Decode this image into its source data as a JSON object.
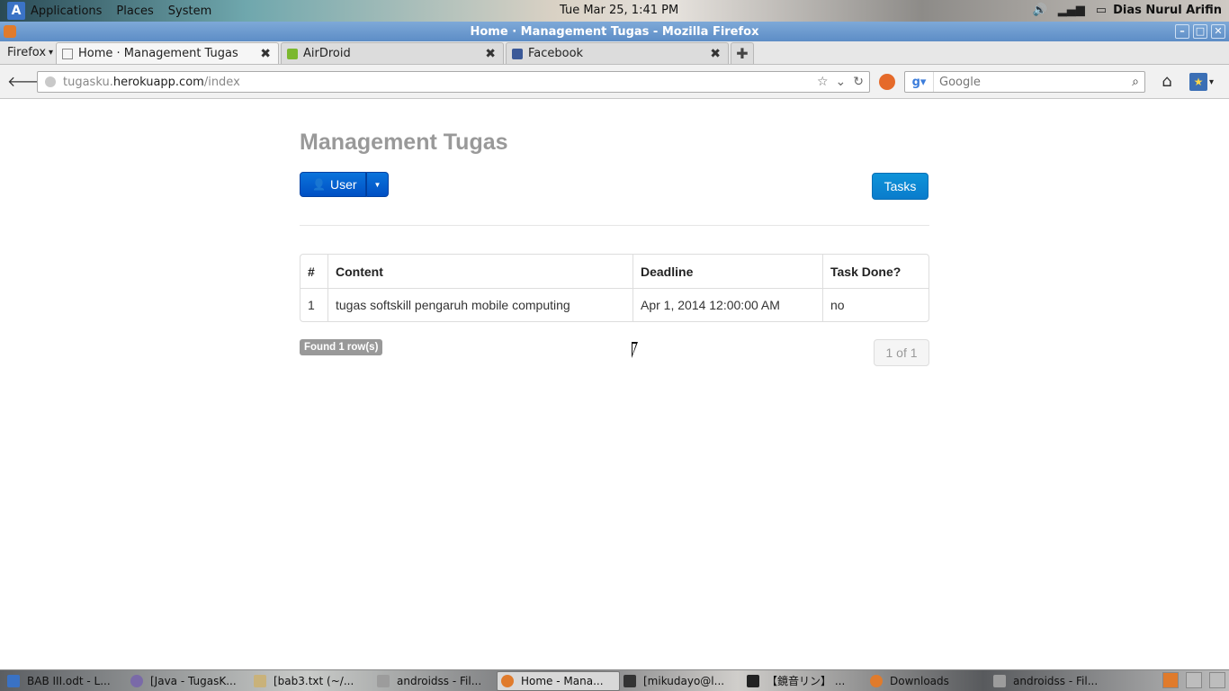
{
  "top_panel": {
    "menus": [
      "Applications",
      "Places",
      "System"
    ],
    "clock": "Tue Mar 25,  1:41 PM",
    "username": "Dias Nurul Arifin"
  },
  "window": {
    "title": "Home · Management Tugas - Mozilla Firefox"
  },
  "browser": {
    "menu_label": "Firefox",
    "tabs": [
      {
        "label": "Home · Management Tugas",
        "active": true,
        "icon": "page-icon"
      },
      {
        "label": "AirDroid",
        "active": false,
        "icon": "airdroid-icon"
      },
      {
        "label": "Facebook",
        "active": false,
        "icon": "facebook-icon"
      }
    ],
    "url": {
      "host_pre": "tugasku.",
      "host": "herokuapp.com",
      "path": "/index"
    },
    "search_placeholder": "Google"
  },
  "page": {
    "title": "Management Tugas",
    "user_button": "User",
    "tasks_button": "Tasks",
    "table": {
      "headers": [
        "#",
        "Content",
        "Deadline",
        "Task Done?"
      ],
      "rows": [
        [
          "1",
          "tugas softskill pengaruh mobile computing",
          "Apr 1, 2014 12:00:00 AM",
          "no"
        ]
      ]
    },
    "found_badge": "Found 1 row(s)",
    "pager": "1 of 1"
  },
  "taskbar": {
    "items": [
      {
        "label": "BAB III.odt - L...",
        "active": false
      },
      {
        "label": "[Java - TugasK...",
        "active": false
      },
      {
        "label": "[bab3.txt (~/...",
        "active": false
      },
      {
        "label": "androidss - Fil...",
        "active": false
      },
      {
        "label": "Home - Mana...",
        "active": true
      },
      {
        "label": "[mikudayo@l...",
        "active": false
      },
      {
        "label": "【鏡音リン】 ...",
        "active": false
      },
      {
        "label": "Downloads",
        "active": false
      },
      {
        "label": "androidss - Fil...",
        "active": false
      }
    ]
  }
}
